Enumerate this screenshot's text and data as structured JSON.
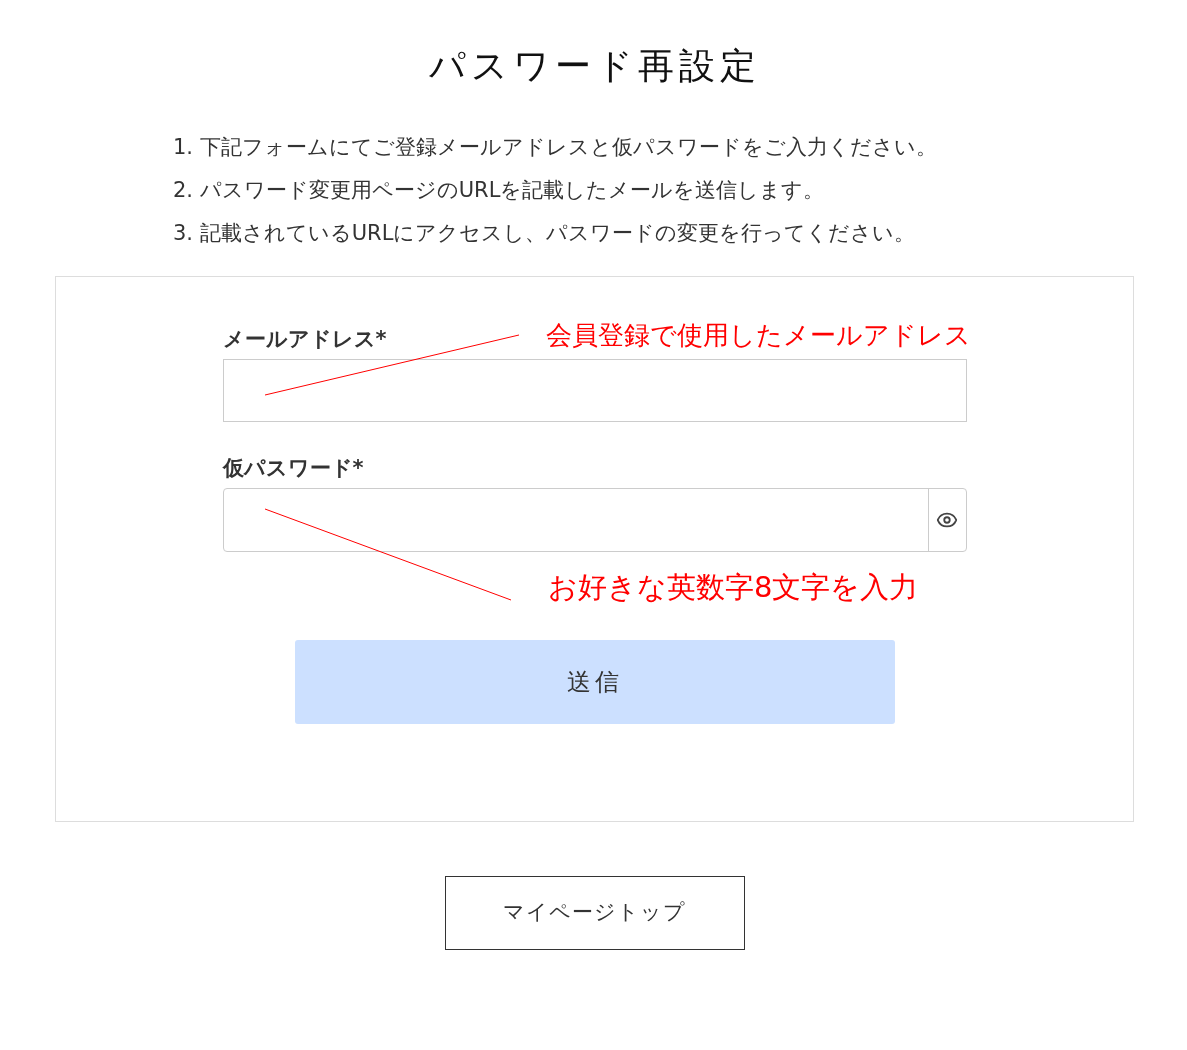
{
  "page": {
    "title": "パスワード再設定"
  },
  "instructions": [
    "1. 下記フォームにてご登録メールアドレスと仮パスワードをご入力ください。",
    "2. パスワード変更用ページのURLを記載したメールを送信します。",
    "3. 記載されているURLにアクセスし、パスワードの変更を行ってください。"
  ],
  "form": {
    "fields": [
      {
        "label": "メールアドレス*",
        "kind": "text"
      },
      {
        "label": "仮パスワード*",
        "kind": "password"
      }
    ],
    "submit": "送信"
  },
  "annotations": [
    {
      "text": "会員登録で使用したメールアドレス",
      "color": "#ff0000"
    },
    {
      "text": "お好きな英数字8文字を入力",
      "color": "#ff0000"
    }
  ],
  "footer": {
    "button": "マイページトップ"
  }
}
